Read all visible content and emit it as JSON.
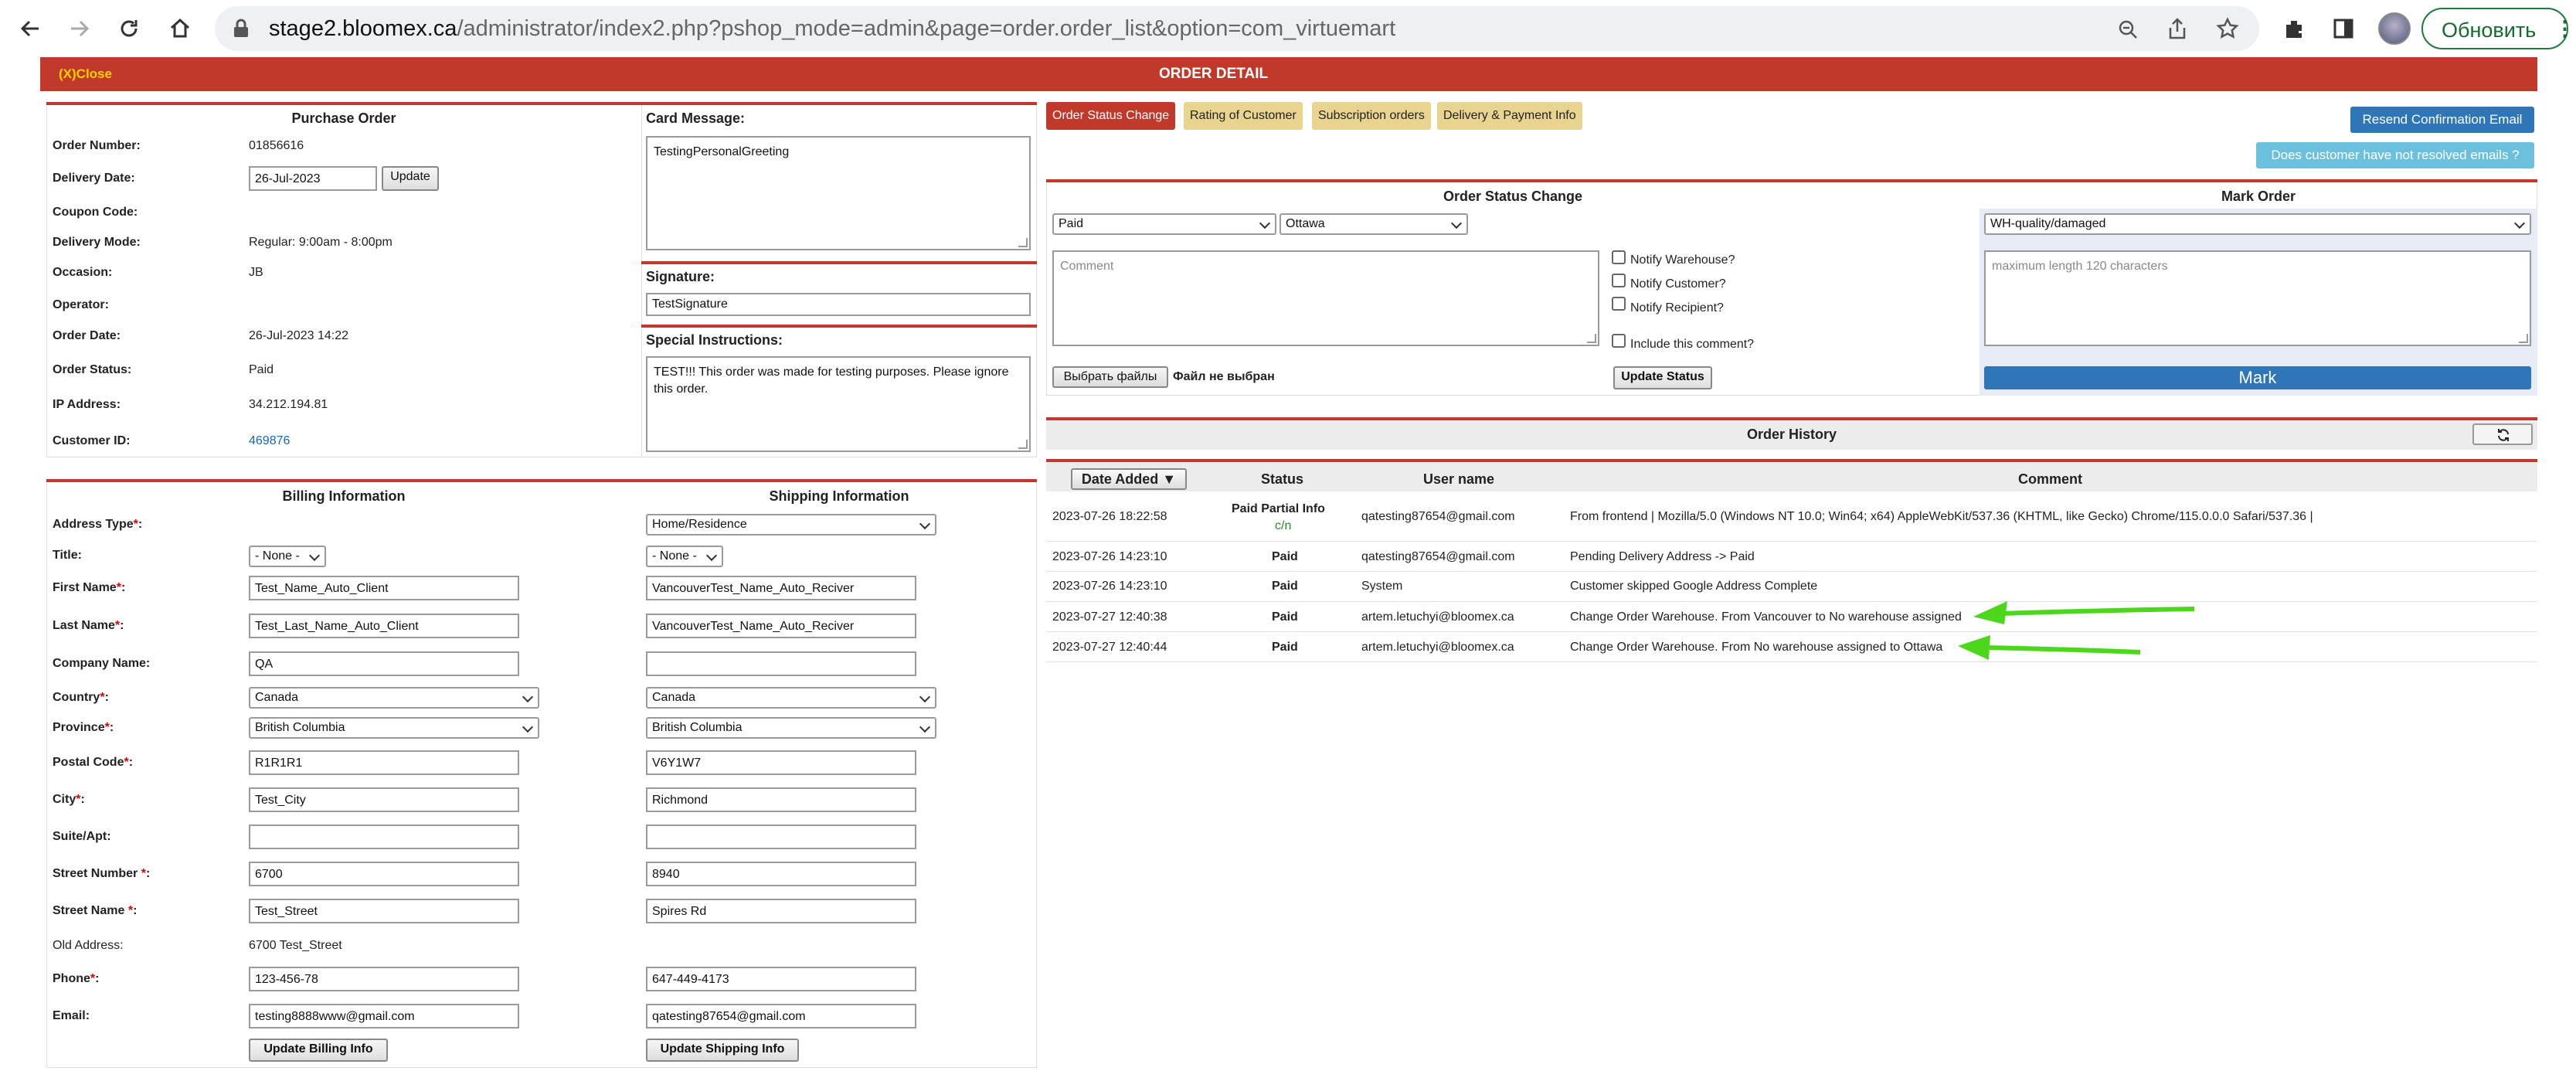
{
  "browser": {
    "url_host": "stage2.bloomex.ca",
    "url_path": "/administrator/index2.php?pshop_mode=admin&page=order.order_list&option=com_virtuemart",
    "update_label": "Обновить"
  },
  "header": {
    "close_label": "(X)Close",
    "title": "ORDER DETAIL"
  },
  "purchase": {
    "title": "Purchase Order",
    "order_number_label": "Order Number:",
    "order_number": "01856616",
    "delivery_date_label": "Delivery Date:",
    "delivery_date": "26-Jul-2023",
    "update_label": "Update",
    "coupon_label": "Coupon Code:",
    "delivery_mode_label": "Delivery Mode:",
    "delivery_mode": "Regular: 9:00am - 8:00pm",
    "occasion_label": "Occasion:",
    "occasion": "JB",
    "operator_label": "Operator:",
    "order_date_label": "Order Date:",
    "order_date": "26-Jul-2023 14:22",
    "order_status_label": "Order Status:",
    "order_status": "Paid",
    "ip_label": "IP Address:",
    "ip": "34.212.194.81",
    "customer_id_label": "Customer ID:",
    "customer_id": "469876"
  },
  "card": {
    "message_label": "Card Message:",
    "message": "TestingPersonalGreeting",
    "signature_label": "Signature:",
    "signature": "TestSignature",
    "instructions_label": "Special Instructions:",
    "instructions": "TEST!!! This order was made for testing purposes. Please ignore this order."
  },
  "address": {
    "billing_title": "Billing Information",
    "shipping_title": "Shipping Information",
    "labels": {
      "address_type": "Address Type",
      "title": "Title:",
      "first_name": "First Name",
      "last_name": "Last Name",
      "company": "Company Name:",
      "country": "Country",
      "province": "Province",
      "postal": "Postal Code",
      "city": "City",
      "suite": "Suite/Apt:",
      "street_number": "Street Number ",
      "street_name": "Street Name ",
      "old_address": "Old Address:",
      "phone": "Phone",
      "email": "Email:",
      "star": "*",
      "colon": ":"
    },
    "billing": {
      "title": "- None -",
      "first_name": "Test_Name_Auto_Client",
      "last_name": "Test_Last_Name_Auto_Client",
      "company": "QA",
      "country": "Canada",
      "province": "British Columbia",
      "postal": "R1R1R1",
      "city": "Test_City",
      "suite": "",
      "street_number": "6700",
      "street_name": "Test_Street",
      "old_address": "6700 Test_Street",
      "phone": "123-456-78",
      "email": "testing8888www@gmail.com",
      "update_label": "Update Billing Info"
    },
    "shipping": {
      "address_type": "Home/Residence",
      "title": "- None -",
      "first_name": "VancouverTest_Name_Auto_Reciver",
      "last_name": "VancouverTest_Name_Auto_Reciver",
      "company": "",
      "country": "Canada",
      "province": "British Columbia",
      "postal": "V6Y1W7",
      "city": "Richmond",
      "suite": "",
      "street_number": "8940",
      "street_name": "Spires Rd",
      "phone": "647-449-4173",
      "email": "qatesting87654@gmail.com",
      "update_label": "Update Shipping Info"
    }
  },
  "tabs": [
    "Order Status Change",
    "Rating of Customer",
    "Subscription orders",
    "Delivery & Payment Info"
  ],
  "actions": {
    "resend_label": "Resend Confirmation Email",
    "unresolved_label": "Does customer have not resolved emails ?"
  },
  "status_change": {
    "title": "Order Status Change",
    "status_value": "Paid",
    "warehouse_value": "Ottawa",
    "comment_placeholder": "Comment",
    "notify_warehouse": "Notify Warehouse?",
    "notify_customer": "Notify Customer?",
    "notify_recipient": "Notify Recipient?",
    "include_comment": "Include this comment?",
    "choose_files": "Выбрать файлы",
    "no_file": "Файл не выбран",
    "update_label": "Update Status"
  },
  "mark_order": {
    "title": "Mark Order",
    "select_value": "WH-quality/damaged",
    "placeholder": "maximum length 120 characters",
    "mark_label": "Mark"
  },
  "history": {
    "title": "Order History",
    "columns": [
      "Date Added",
      "Status",
      "User name",
      "Comment"
    ],
    "sort_arrow": "▼",
    "rows": [
      {
        "date": "2023-07-26 18:22:58",
        "status": "Paid Partial Info",
        "sub": "c/n",
        "user": "qatesting87654@gmail.com",
        "comment": "From frontend | Mozilla/5.0 (Windows NT 10.0; Win64; x64) AppleWebKit/537.36 (KHTML, like Gecko) Chrome/115.0.0.0 Safari/537.36 |"
      },
      {
        "date": "2023-07-26 14:23:10",
        "status": "Paid",
        "user": "qatesting87654@gmail.com",
        "comment": "Pending Delivery Address -> Paid"
      },
      {
        "date": "2023-07-26 14:23:10",
        "status": "Paid",
        "user": "System",
        "comment": "Customer skipped Google Address Complete"
      },
      {
        "date": "2023-07-27 12:40:38",
        "status": "Paid",
        "user": "artem.letuchyi@bloomex.ca",
        "comment": "Change Order Warehouse. From Vancouver to No warehouse assigned"
      },
      {
        "date": "2023-07-27 12:40:44",
        "status": "Paid",
        "user": "artem.letuchyi@bloomex.ca",
        "comment": "Change Order Warehouse. From No warehouse assigned to Ottawa"
      }
    ]
  },
  "colors": {
    "accent_red": "#c0392b",
    "arrow_green": "#4cd61c",
    "link_blue": "#1a64b5",
    "mark_blue": "#2f76b9"
  },
  "icons": [
    "back-arrow-icon",
    "forward-arrow-icon",
    "reload-icon",
    "home-icon",
    "site-info-icon",
    "zoom-icon",
    "share-icon",
    "star-icon",
    "extensions-icon",
    "side-panel-icon",
    "refresh-icon"
  ]
}
